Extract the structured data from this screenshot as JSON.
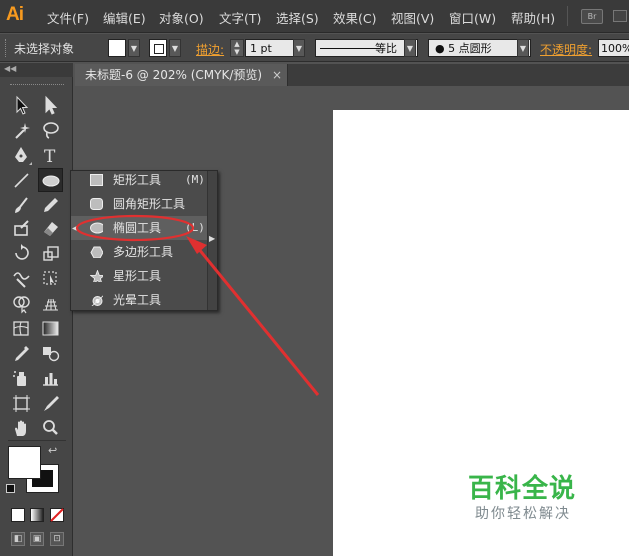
{
  "app": {
    "logo": "Ai"
  },
  "menu": {
    "items": [
      "文件(F)",
      "编辑(E)",
      "对象(O)",
      "文字(T)",
      "选择(S)",
      "效果(C)",
      "视图(V)",
      "窗口(W)",
      "帮助(H)"
    ],
    "bridge_label": "Br"
  },
  "control_bar": {
    "selection_status": "未选择对象",
    "stroke_label": "描边:",
    "stroke_weight": "1 pt",
    "profile_label": "等比",
    "brush_label": "● 5 点圆形",
    "opacity_label": "不透明度:",
    "opacity_value": "100%"
  },
  "document": {
    "tab_title": "未标题-6 @ 202% (CMYK/预览)",
    "close_glyph": "×"
  },
  "flyout": {
    "items": [
      {
        "label": "矩形工具",
        "shortcut": "(M)",
        "icon": "rectangle-icon"
      },
      {
        "label": "圆角矩形工具",
        "shortcut": "",
        "icon": "rounded-rectangle-icon"
      },
      {
        "label": "椭圆工具",
        "shortcut": "(L)",
        "icon": "ellipse-icon"
      },
      {
        "label": "多边形工具",
        "shortcut": "",
        "icon": "polygon-icon"
      },
      {
        "label": "星形工具",
        "shortcut": "",
        "icon": "star-icon"
      },
      {
        "label": "光晕工具",
        "shortcut": "",
        "icon": "flare-icon"
      }
    ],
    "active_index": 2
  },
  "annotation": {
    "color": "#e03030"
  },
  "watermark": {
    "title": "百科全说",
    "subtitle": "助你轻松解决"
  },
  "colors": {
    "accent_orange": "#f79a1f",
    "watermark_green": "#39b54a"
  }
}
